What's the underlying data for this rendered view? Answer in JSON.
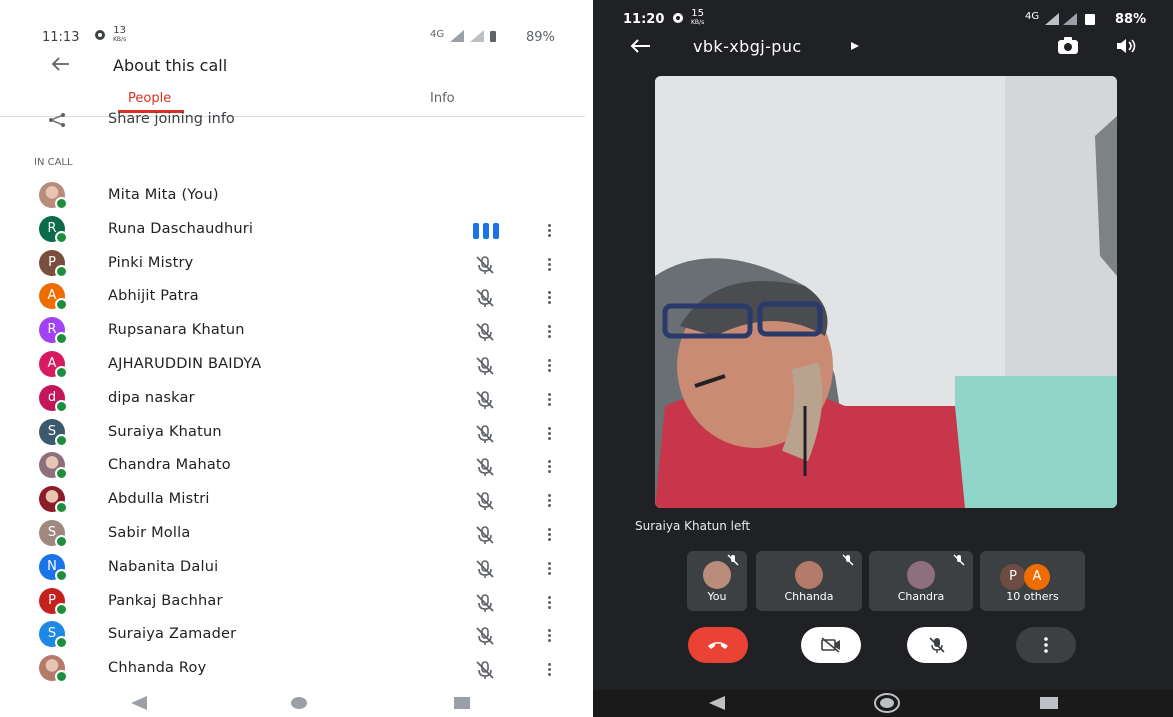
{
  "left": {
    "status": {
      "time": "11:13",
      "speed": "13",
      "speed_unit": "KB/s",
      "network": "4G",
      "battery": "89%"
    },
    "header": {
      "title": "About this call"
    },
    "tabs": [
      {
        "label": "People",
        "active": true
      },
      {
        "label": "Info",
        "active": false
      }
    ],
    "share_label": "Share joining info",
    "section_label": "IN CALL",
    "participants": [
      {
        "name": "Mita Mita (You)",
        "initial": "",
        "color": "#b98c7c",
        "photo": true,
        "mic": "none"
      },
      {
        "name": "Runa Daschaudhuri",
        "initial": "R",
        "color": "#0b6b4b",
        "photo": false,
        "mic": "speaking"
      },
      {
        "name": "Pinki Mistry",
        "initial": "P",
        "color": "#7a4f3f",
        "photo": false,
        "mic": "muted"
      },
      {
        "name": "Abhijit Patra",
        "initial": "A",
        "color": "#ef6c00",
        "photo": false,
        "mic": "muted"
      },
      {
        "name": "Rupsanara Khatun",
        "initial": "R",
        "color": "#a142f4",
        "photo": false,
        "mic": "muted"
      },
      {
        "name": "AJHARUDDIN BAIDYA",
        "initial": "A",
        "color": "#d81b60",
        "photo": false,
        "mic": "muted"
      },
      {
        "name": "dipa naskar",
        "initial": "d",
        "color": "#c2185b",
        "photo": false,
        "mic": "muted"
      },
      {
        "name": "Suraiya Khatun",
        "initial": "S",
        "color": "#3c5a6e",
        "photo": false,
        "mic": "muted"
      },
      {
        "name": "Chandra Mahato",
        "initial": "",
        "color": "#8e6f7c",
        "photo": true,
        "mic": "muted"
      },
      {
        "name": "Abdulla Mistri",
        "initial": "",
        "color": "#8c1c2a",
        "photo": true,
        "mic": "muted"
      },
      {
        "name": "Sabir Molla",
        "initial": "S",
        "color": "#a1887f",
        "photo": false,
        "mic": "muted"
      },
      {
        "name": "Nabanita Dalui",
        "initial": "N",
        "color": "#1a73e8",
        "photo": false,
        "mic": "muted"
      },
      {
        "name": "Pankaj Bachhar",
        "initial": "P",
        "color": "#c5221f",
        "photo": false,
        "mic": "muted"
      },
      {
        "name": "Suraiya Zamader",
        "initial": "S",
        "color": "#1e88e5",
        "photo": false,
        "mic": "muted"
      },
      {
        "name": "Chhanda Roy",
        "initial": "",
        "color": "#b47a6a",
        "photo": true,
        "mic": "muted"
      }
    ]
  },
  "right": {
    "status": {
      "time": "11:20",
      "speed": "15",
      "speed_unit": "KB/s",
      "network": "4G",
      "battery": "88%"
    },
    "meeting_code": "vbk-xbgj-puc",
    "toast": "Suraiya Khatun left",
    "tiles": [
      {
        "label": "You"
      },
      {
        "label": "Chhanda"
      },
      {
        "label": "Chandra"
      },
      {
        "label": "10 others",
        "initials": [
          "P",
          "A"
        ]
      }
    ]
  }
}
